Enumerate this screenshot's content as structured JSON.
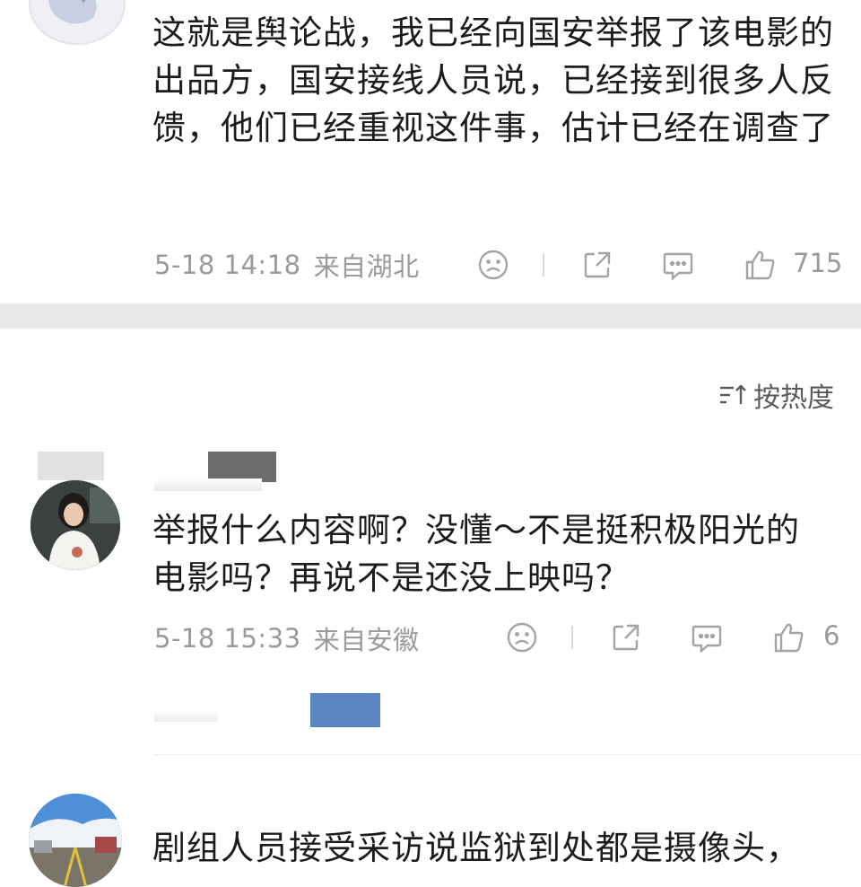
{
  "comments": [
    {
      "text": "这就是舆论战，我已经向国安举报了该电影的出品方，国安接线人员说，已经接到很多人反馈，他们已经重视这件事，估计已经在调查了",
      "time": "5-18 14:18",
      "location": "来自湖北",
      "likes": "715"
    },
    {
      "text": "举报什么内容啊？没懂～不是挺积极阳光的电影吗？再说不是还没上映吗？",
      "time": "5-18 15:33",
      "location": "来自安徽",
      "likes": "6"
    },
    {
      "text": "剧组人员接受采访说监狱到处都是摄像头，"
    }
  ],
  "sort": {
    "label": "按热度"
  },
  "icons": {
    "dislike": "frown-icon",
    "share": "share-icon",
    "reply": "comment-icon",
    "like": "thumbs-up-icon",
    "sort": "sort-icon"
  },
  "colors": {
    "meta_text": "#9a9a9a",
    "divider": "#e8e8e8",
    "redact_gray": "#6b6b6b",
    "redact_blue": "#5a87c2"
  }
}
